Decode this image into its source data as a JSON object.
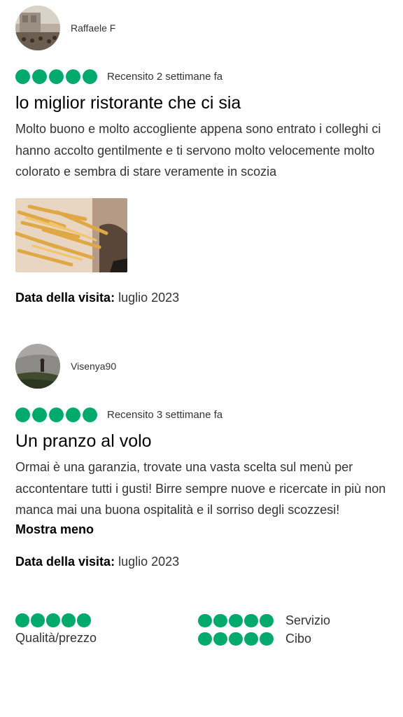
{
  "reviews": [
    {
      "author": "Raffaele F",
      "rating": 5,
      "reviewed": "Recensito 2 settimane fa",
      "title": "lo miglior ristorante che ci sia",
      "body": "Molto buono e molto accogliente appena sono entrato i colleghi ci hanno accolto gentilmente e ti servono molto velocemente molto colorato e sembra di stare veramente in scozia",
      "visit_label": "Data della visita:",
      "visit_date": "luglio 2023"
    },
    {
      "author": "Visenya90",
      "rating": 5,
      "reviewed": "Recensito 3 settimane fa",
      "title": "Un pranzo al volo",
      "body": "Ormai è una garanzia, trovate una vasta scelta sul menù per accontentare tutti i gusti! Birre sempre nuove e ricercate in più non manca mai una buona ospitalità e il sorriso degli scozzesi!",
      "show_less": "Mostra meno",
      "visit_label": "Data della visita:",
      "visit_date": "luglio 2023"
    }
  ],
  "sub_ratings": [
    {
      "label": "Qualità/prezzo",
      "rating": 5
    },
    {
      "label": "Servizio",
      "rating": 5
    },
    {
      "label": "Cibo",
      "rating": 5
    }
  ],
  "colors": {
    "bubble": "#00aa6c"
  }
}
